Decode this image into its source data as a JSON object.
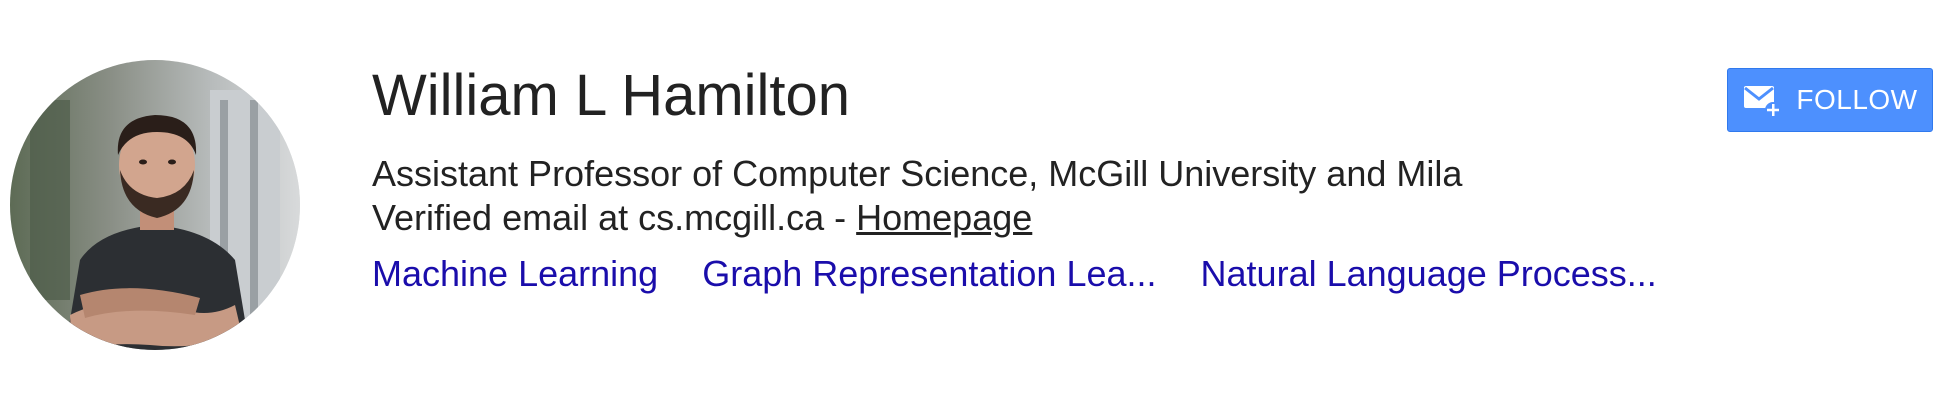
{
  "profile": {
    "name": "William L Hamilton",
    "affiliation": "Assistant Professor of Computer Science, McGill University and Mila",
    "email_text": "Verified email at cs.mcgill.ca - ",
    "homepage_label": "Homepage",
    "interests": [
      "Machine Learning",
      "Graph Representation Lea...",
      "Natural Language Process..."
    ],
    "avatar_icon": "profile-photo"
  },
  "follow": {
    "label": "FOLLOW",
    "icon": "mail-plus-icon"
  },
  "colors": {
    "link": "#1a0dab",
    "button_bg": "#4d90fe",
    "text": "#222222"
  }
}
